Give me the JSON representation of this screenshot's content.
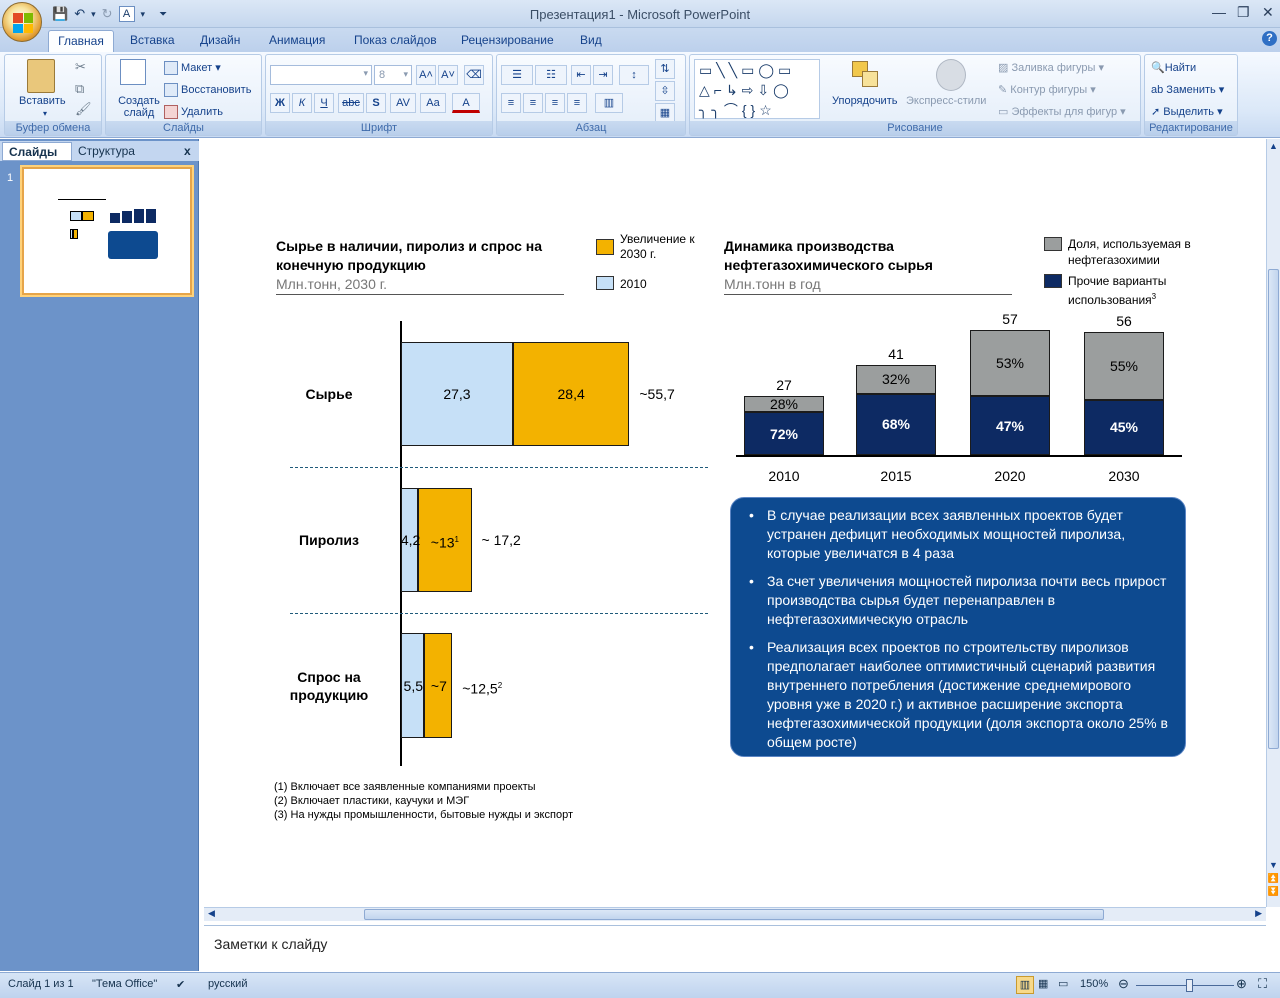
{
  "window": {
    "title": "Презентация1 - Microsoft PowerPoint"
  },
  "ribbon": {
    "tabs": [
      "Главная",
      "Вставка",
      "Дизайн",
      "Анимация",
      "Показ слайдов",
      "Рецензирование",
      "Вид"
    ],
    "clipboard": {
      "label": "Буфер обмена",
      "paste": "Вставить"
    },
    "slides": {
      "label": "Слайды",
      "new_slide": "Создать слайд",
      "layout": "Макет",
      "reset": "Восстановить",
      "delete": "Удалить"
    },
    "font": {
      "label": "Шрифт",
      "size": "8",
      "bold": "Ж",
      "italic": "К",
      "underline": "Ч",
      "strike": "abc",
      "shadow": "S",
      "spacing": "AV",
      "case": "Aa"
    },
    "paragraph": {
      "label": "Абзац"
    },
    "drawing": {
      "label": "Рисование",
      "arrange": "Упорядочить",
      "quick_styles": "Экспресс-стили",
      "fill": "Заливка фигуры",
      "outline": "Контур фигуры",
      "effects": "Эффекты для фигур"
    },
    "editing": {
      "label": "Редактирование",
      "find": "Найти",
      "replace": "Заменить",
      "select": "Выделить"
    }
  },
  "left_pane": {
    "tab_slides": "Слайды",
    "tab_outline": "Структура",
    "close": "x",
    "slide_number": "1"
  },
  "slide": {
    "left_title": "Сырье в наличии, пиролиз и спрос на конечную продукцию",
    "left_subtitle": "Млн.тонн, 2030 г.",
    "legend_increase": "Увеличение к 2030 г.",
    "legend_2010": "2010",
    "right_title": "Динамика производства нефтегазохимического сырья",
    "right_subtitle": "Млн.тонн в год",
    "legend_share": "Доля, используемая в нефтегазохимии",
    "legend_other": "Прочие варианты использования",
    "legend_other_sup": "3",
    "bullets": [
      "В случае реализации всех заявленных проектов будет устранен дефицит необходимых мощностей пиролиза, которые увеличатся в 4 раза",
      "За счет увеличения мощностей пиролиза почти весь прирост производства сырья будет перенаправлен в нефтегазохимическую отрасль",
      "Реализация всех проектов по строительству пиролизов предполагает наиболее оптимистичный сценарий развития внутреннего потребления (достижение среднемирового уровня уже в 2020 г.)  и активное расширение экспорта нефтегазохимической продукции (доля экспорта около 25% в общем росте)"
    ],
    "footnotes": [
      "(1) Включает все заявленные компаниями проекты",
      "(2) Включает пластики, каучуки и МЭГ",
      "(3) На нужды промышленности, бытовые нужды и экспорт"
    ]
  },
  "chart_data": [
    {
      "type": "bar",
      "orientation": "horizontal",
      "stacked": true,
      "categories": [
        "Сырье",
        "Пиролиз",
        "Спрос на продукцию"
      ],
      "series": [
        {
          "name": "2010",
          "values": [
            27.3,
            4.2,
            5.5
          ],
          "labels": [
            "27,3",
            "4,2",
            "5,5"
          ],
          "color": "#c6e0f7"
        },
        {
          "name": "Увеличение к 2030 г.",
          "values": [
            28.4,
            13,
            7
          ],
          "labels": [
            "28,4",
            "~13",
            "~7"
          ],
          "label_sups": [
            "",
            "1",
            ""
          ],
          "color": "#f3b200"
        }
      ],
      "totals": [
        "~55,7",
        "~ 17,2",
        "~12,5"
      ],
      "total_sups": [
        "",
        "",
        "2"
      ]
    },
    {
      "type": "bar",
      "stacked": true,
      "categories": [
        "2010",
        "2015",
        "2020",
        "2030"
      ],
      "totals": [
        27,
        41,
        57,
        56
      ],
      "series": [
        {
          "name": "Прочие варианты использования",
          "values": [
            72,
            68,
            47,
            45
          ],
          "labels": [
            "72%",
            "68%",
            "47%",
            "45%"
          ],
          "color": "#0d2a63"
        },
        {
          "name": "Доля, используемая в нефтегазохимии",
          "values": [
            28,
            32,
            53,
            55
          ],
          "labels": [
            "28%",
            "32%",
            "53%",
            "55%"
          ],
          "color": "#9b9e9e"
        }
      ]
    }
  ],
  "notes": {
    "placeholder": "Заметки к слайду"
  },
  "status": {
    "slide": "Слайд 1 из 1",
    "theme": "\"Тема Office\"",
    "language": "русский",
    "zoom": "150%"
  }
}
